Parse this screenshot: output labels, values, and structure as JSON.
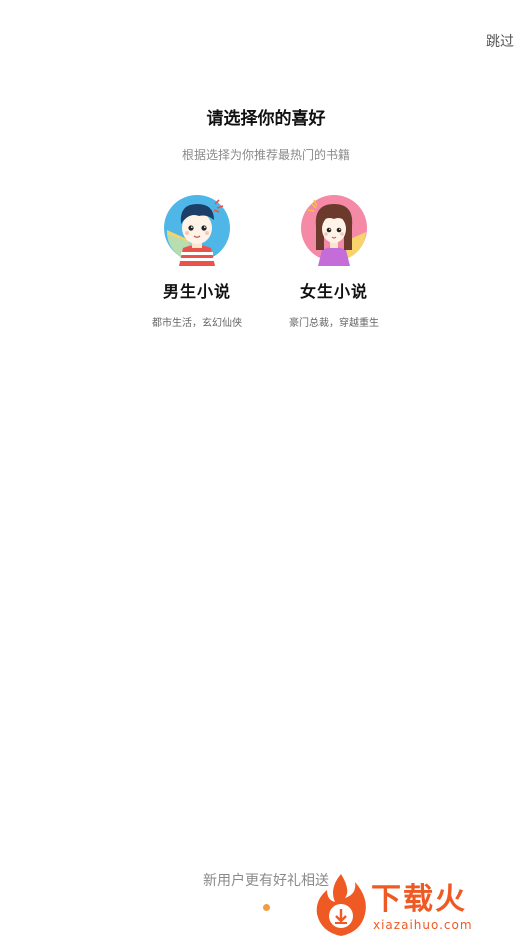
{
  "header": {
    "skip_label": "跳过"
  },
  "main": {
    "title": "请选择你的喜好",
    "subtitle": "根据选择为你推荐最热门的书籍",
    "choices": [
      {
        "label": "男生小说",
        "desc": "都市生活，玄幻仙侠",
        "avatar_icon": "boy-avatar-icon",
        "bg_color": "#4fb7e8"
      },
      {
        "label": "女生小说",
        "desc": "豪门总裁，穿越重生",
        "avatar_icon": "girl-avatar-icon",
        "bg_color": "#f48aa6"
      }
    ]
  },
  "footer": {
    "note": "新用户更有好礼相送",
    "page_indicator": {
      "count": 1,
      "active": 0
    },
    "accent_color": "#f39c3a"
  },
  "watermark": {
    "brand": "下载火",
    "url": "xiazaihuo.com",
    "color": "#ef5a24"
  }
}
